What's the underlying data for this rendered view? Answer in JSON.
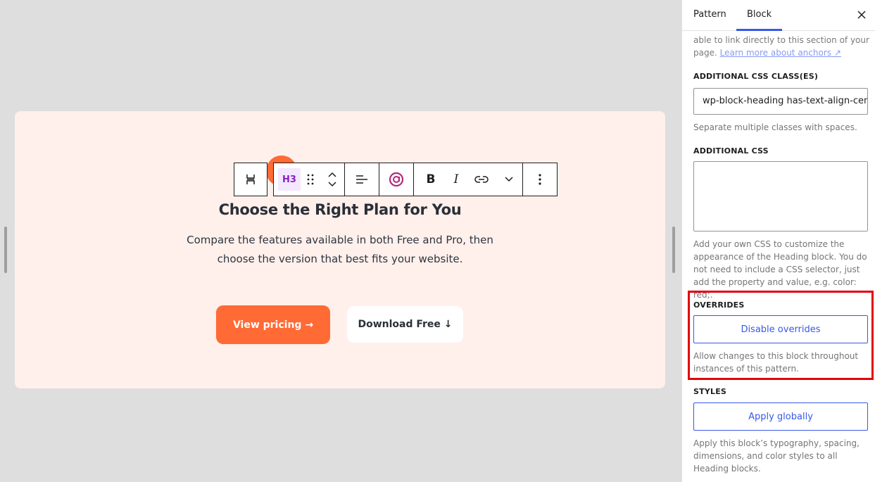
{
  "canvas": {
    "heading": "Choose the Right Plan for You",
    "description": "Compare the features available in both Free and Pro, then choose the version that best fits your website.",
    "primary_button": "View pricing →",
    "secondary_button": "Download Free ↓"
  },
  "toolbar": {
    "heading_level": "H3",
    "icons": [
      "select-parent-icon",
      "drag-handle-icon",
      "move-up-icon",
      "move-down-icon",
      "align-icon",
      "plugin-icon",
      "bold-icon",
      "italic-icon",
      "link-icon",
      "more-rich-text-icon",
      "options-icon"
    ],
    "bold_glyph": "B",
    "italic_glyph": "I"
  },
  "sidebar": {
    "tabs": [
      "Pattern",
      "Block"
    ],
    "active_tab": "Block",
    "anchor_help_text": "able to link directly to this section of your page.",
    "anchor_link": "Learn more about anchors ↗",
    "css_classes_label": "ADDITIONAL CSS CLASS(ES)",
    "css_classes_value": "wp-block-heading has-text-align-center",
    "css_classes_help": "Separate multiple classes with spaces.",
    "additional_css_label": "ADDITIONAL CSS",
    "additional_css_value": "",
    "additional_css_help": "Add your own CSS to customize the appearance of the Heading block. You do not need to include a CSS selector, just add the property and value, e.g. color: red;.",
    "overrides_label": "OVERRIDES",
    "overrides_button": "Disable overrides",
    "overrides_help": "Allow changes to this block throughout instances of this pattern.",
    "styles_label": "STYLES",
    "styles_button": "Apply globally",
    "styles_help": "Apply this block’s typography, spacing, dimensions, and color styles to all Heading blocks."
  },
  "colors": {
    "accent": "#3858e9",
    "brand_orange": "#ff6a35",
    "card_background": "#fff0eb",
    "highlight_border": "#e3000f"
  }
}
